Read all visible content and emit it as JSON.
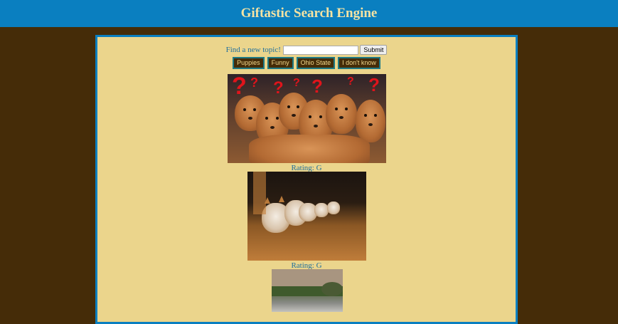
{
  "header": {
    "title": "Giftastic Search Engine"
  },
  "search": {
    "label": "Find a new topic!",
    "value": "",
    "placeholder": "",
    "submit_label": "Submit"
  },
  "topics": [
    "Puppies",
    "Funny",
    "Ohio State",
    "I don't know"
  ],
  "gifs": [
    {
      "rating": "Rating: G",
      "subject": "puppies tilting heads with question marks"
    },
    {
      "rating": "Rating: G",
      "subject": "corgi puppies running across wood floor"
    },
    {
      "rating": "",
      "subject": "outdoor street scene"
    }
  ],
  "colors": {
    "background": "#452c08",
    "header": "#0a7fc0",
    "header_text": "#f5e3a3",
    "panel": "#ebd58c",
    "panel_border": "#0a7fc0",
    "topic_button": "#452c08",
    "topic_button_text": "#f1d98d",
    "text": "#1f6f9e"
  }
}
